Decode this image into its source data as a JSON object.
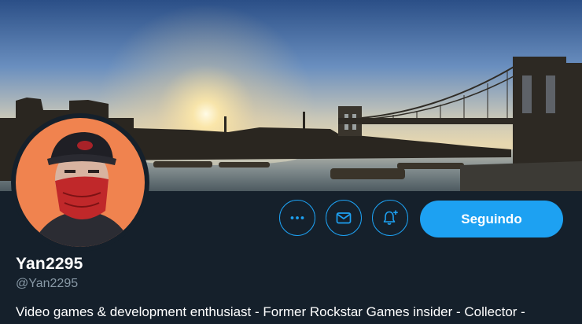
{
  "profile": {
    "display_name": "Yan2295",
    "handle": "@Yan2295",
    "bio": "Video games & development enthusiast - Former Rockstar Games insider - Collector -"
  },
  "actions": {
    "more_icon": "more-horizontal-icon",
    "message_icon": "envelope-icon",
    "notify_icon": "bell-plus-icon",
    "follow_label": "Seguindo"
  },
  "colors": {
    "background": "#15202b",
    "accent": "#1da1f2",
    "secondary_text": "#8899a6",
    "avatar_bg": "#f0834f"
  }
}
